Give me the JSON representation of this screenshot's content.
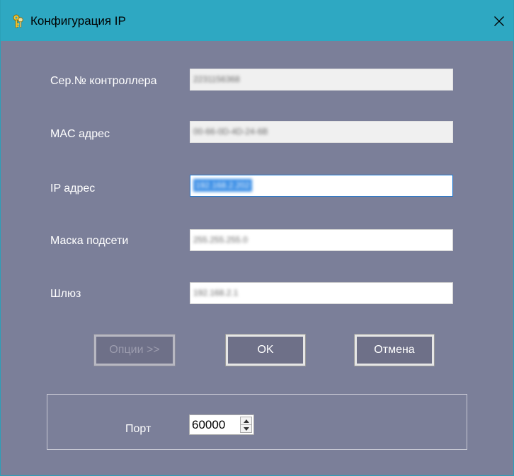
{
  "window": {
    "title": "Конфигурация IP",
    "accent_color": "#2ea8c2",
    "background_color": "#7b7f99"
  },
  "fields": [
    {
      "label": "Сер.№ контроллера",
      "value": "2231156368",
      "readonly": true
    },
    {
      "label": "MAC адрес",
      "value": "00-66-0D-4D-24-6B",
      "readonly": true
    },
    {
      "label": "IP адрес",
      "value": "192.168.2.202",
      "readonly": false
    },
    {
      "label": "Маска подсети",
      "value": "255.255.255.0",
      "readonly": false
    },
    {
      "label": "Шлюз",
      "value": "192.168.2.1",
      "readonly": false
    }
  ],
  "buttons": {
    "options": "Опции >>",
    "ok": "OK",
    "cancel": "Отмена"
  },
  "port": {
    "label": "Порт",
    "value": "60000"
  },
  "icons": {
    "title": "keys-icon",
    "close": "close-icon",
    "spin_up": "spin-up-icon",
    "spin_down": "spin-down-icon"
  }
}
